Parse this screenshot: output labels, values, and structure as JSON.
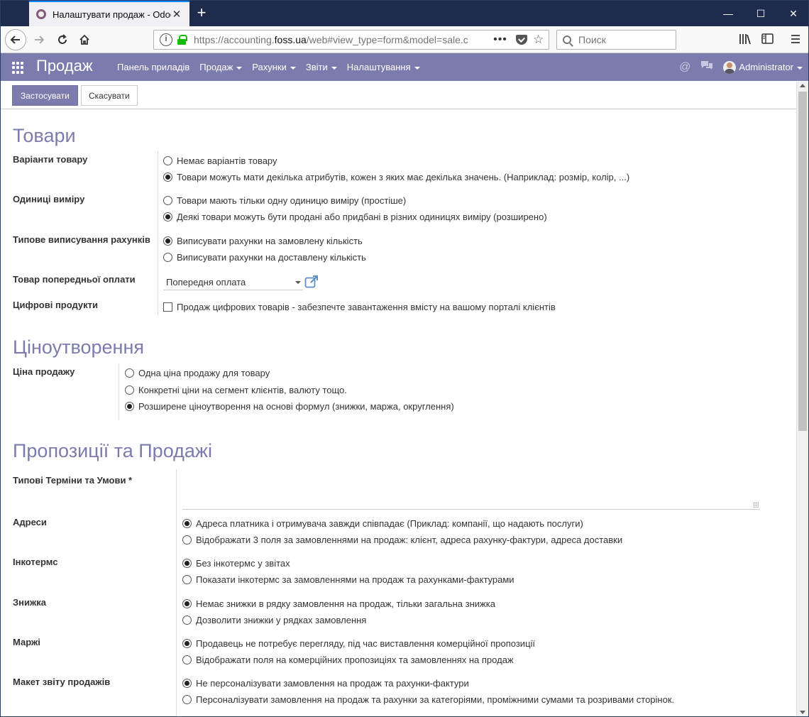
{
  "browser": {
    "tab_title": "Налаштувати продаж - Odoo",
    "url_prefix": "https://accounting.",
    "url_host": "foss.ua",
    "url_rest": "/web#view_type=form&model=sale.c",
    "search_placeholder": "Поиск",
    "accent": "#0a84ff"
  },
  "odoo_menu": {
    "brand": "Продаж",
    "items": [
      "Панель приладів",
      "Продаж",
      "Рахунки",
      "Звіти",
      "Налаштування"
    ],
    "user": "Administrator",
    "color": "#7c7bad"
  },
  "control_panel": {
    "apply": "Застосувати",
    "cancel": "Скасувати"
  },
  "sections": {
    "products": {
      "title": "Товари",
      "variants_label": "Варіанти товару",
      "variants_opt1": "Немає варіантів товару",
      "variants_opt2": "Товари можуть мати декілька атрибутів, кожен з яких має декілька значень. (Наприклад: розмір, колір, ...)",
      "uom_label": "Одиниці виміру",
      "uom_opt1": "Товари мають тільки одну одиницю виміру (простіше)",
      "uom_opt2": "Деякі товари можуть бути продані або придбані в різних одиницях виміру (розширено)",
      "invoicing_label": "Типове виписування рахунків",
      "invoicing_opt1": "Виписувати рахунки на замовлену кількість",
      "invoicing_opt2": "Виписувати рахунки на доставлену кількість",
      "deposit_label": "Товар попередньої оплати",
      "deposit_value": "Попередня оплата",
      "digital_label": "Цифрові продукти",
      "digital_opt": "Продаж цифрових товарів - забезпечте завантаження вмісту на вашому порталі клієнтів"
    },
    "pricing": {
      "title": "Ціноутворення",
      "price_label": "Ціна продажу",
      "price_opt1": "Одна ціна продажу для товару",
      "price_opt2": "Конкретні ціни на сегмент клієнтів, валюту тощо.",
      "price_opt3": "Розширене ціноутворення на основі формул (знижки, маржа, округлення)"
    },
    "quotes": {
      "title": "Пропозиції та Продажі",
      "terms_label": "Типові Терміни та Умови *",
      "address_label": "Адреси",
      "address_opt1": "Адреса платника і отримувача завжди співпадає (Приклад: компанії, що надають послуги)",
      "address_opt2": "Відображати 3 поля за замовленнями на продаж: клієнт, адреса рахунку-фактури, адреса доставки",
      "incoterms_label": "Інкотермс",
      "incoterms_opt1": "Без інкотермс у звітах",
      "incoterms_opt2": "Показати інкотермс за замовленнями на продаж та рахунками-фактурами",
      "discount_label": "Знижка",
      "discount_opt1": "Немає знижки в рядку замовлення на продаж, тільки загальна знижка",
      "discount_opt2": "Дозволити знижки у рядках замовлення",
      "margins_label": "Маржі",
      "margins_opt1": "Продавець не потребує перегляду, під час виставлення комерційної пропозиції",
      "margins_opt2": "Відображати поля на комерційних пропозиціях та замовленнях на продаж",
      "layout_label": "Макет звіту продажів",
      "layout_opt1": "Не персоналізувати замовлення на продаж та рахунки-фактури",
      "layout_opt2": "Персоналізувати замовлення на продаж та рахунки за категоріями, проміжними сумами та розривами сторінок."
    }
  }
}
